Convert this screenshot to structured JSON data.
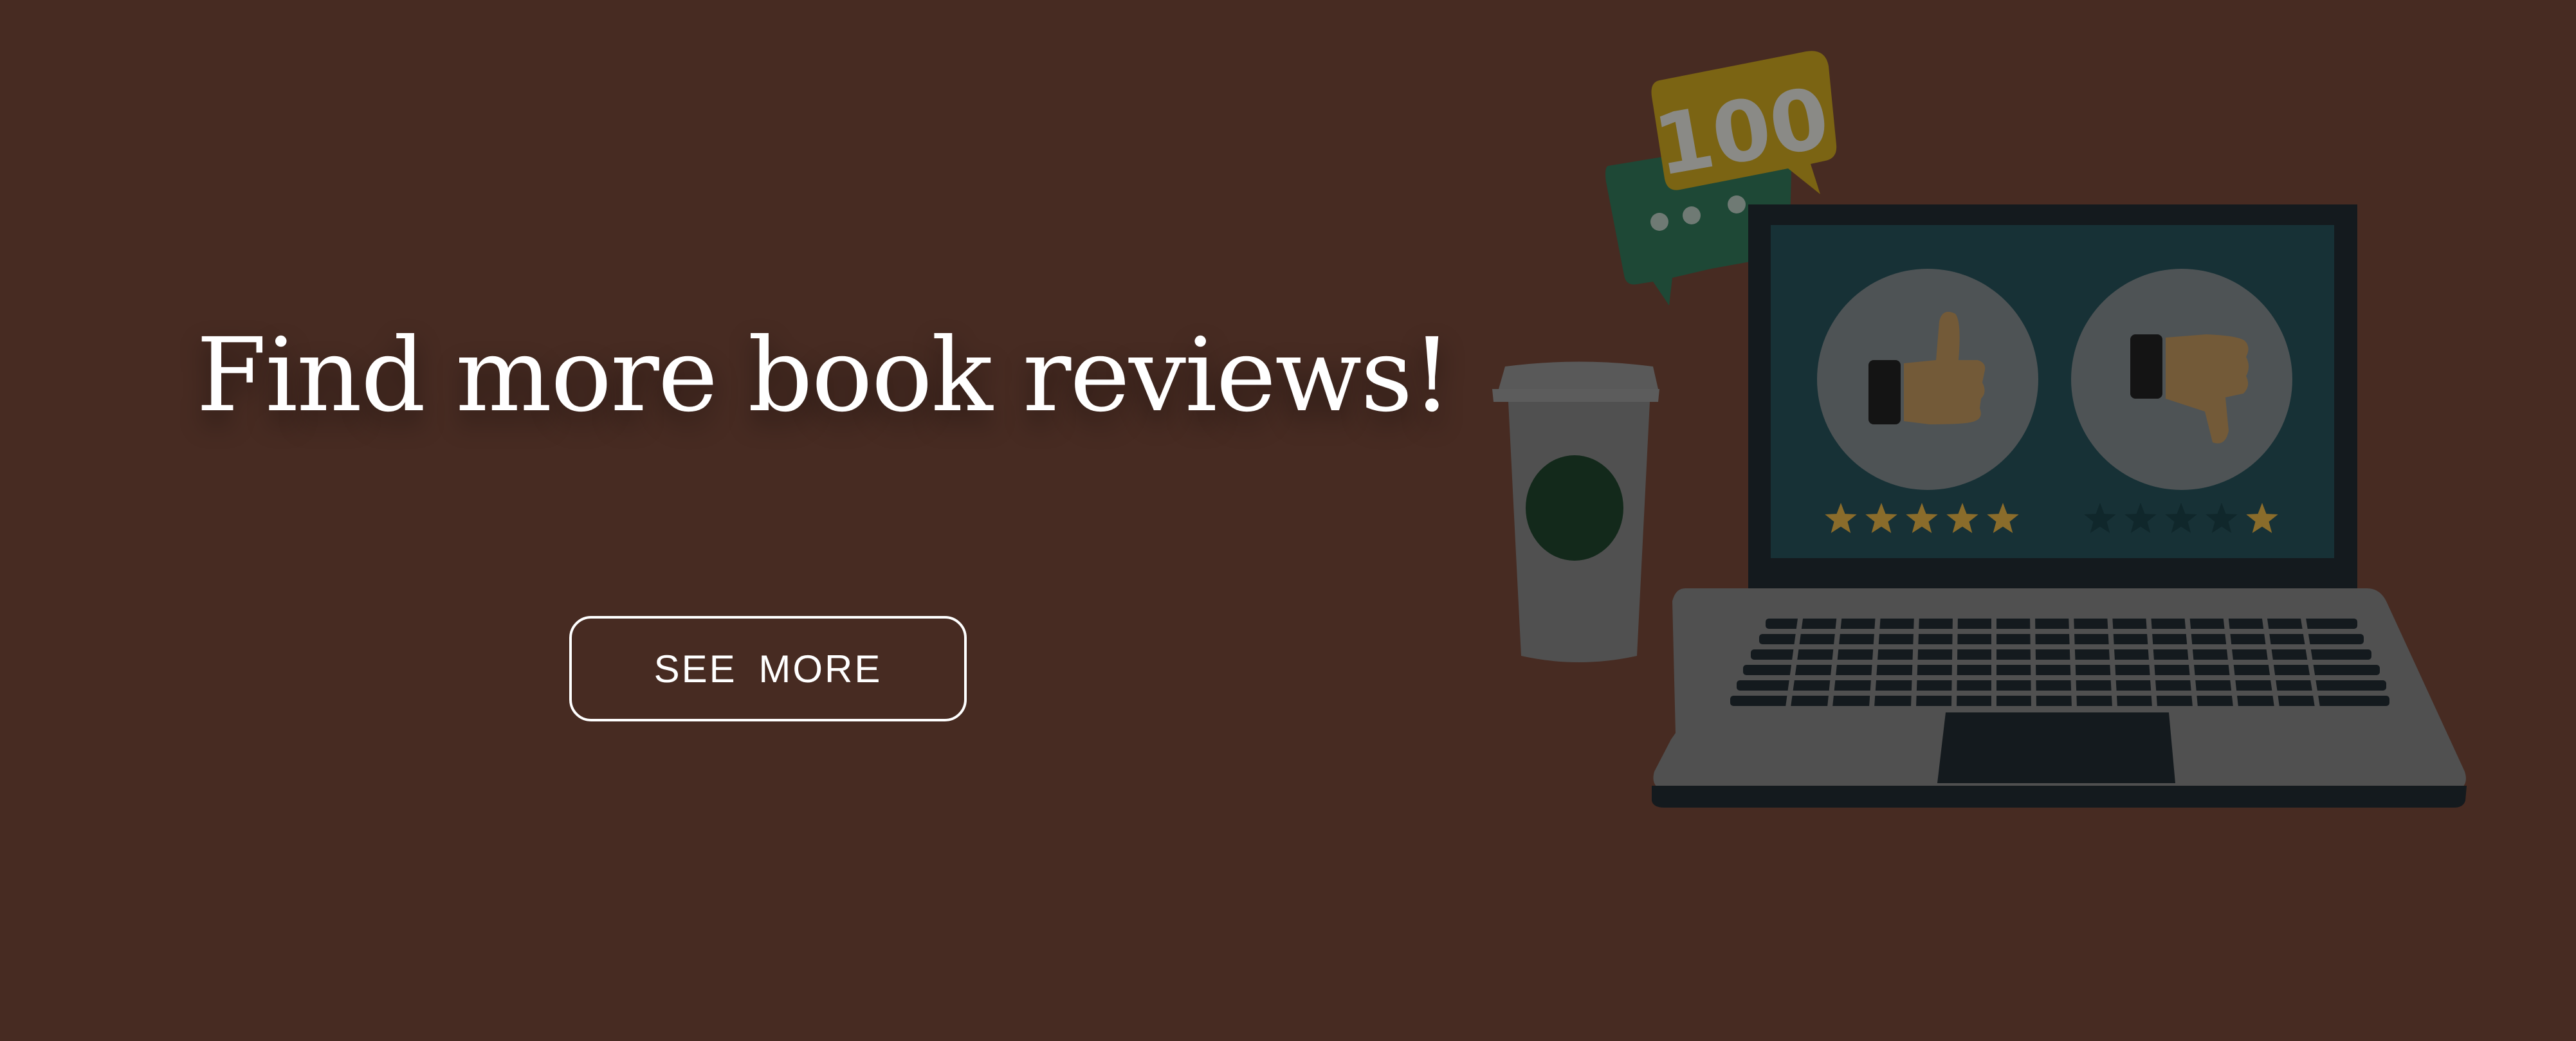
{
  "banner": {
    "headline": "Find more book reviews!",
    "cta_label": "SEE  MORE"
  },
  "illustration": {
    "badge_number": "100",
    "good_rating_stars": 5,
    "bad_rating_stars": 1,
    "icons": [
      "coffee-cup-icon",
      "speech-bubble-icon",
      "thumbs-up-icon",
      "thumbs-down-icon",
      "star-icon",
      "laptop-icon"
    ]
  },
  "colors": {
    "background": "#472b22",
    "text": "#ffffff",
    "star_gold": "#8a6c2b",
    "screen": "#173136",
    "laptop_body": "#505050",
    "keys": "#141a1e",
    "bubble_green": "#1e4836",
    "bubble_gold": "#7b6413"
  }
}
